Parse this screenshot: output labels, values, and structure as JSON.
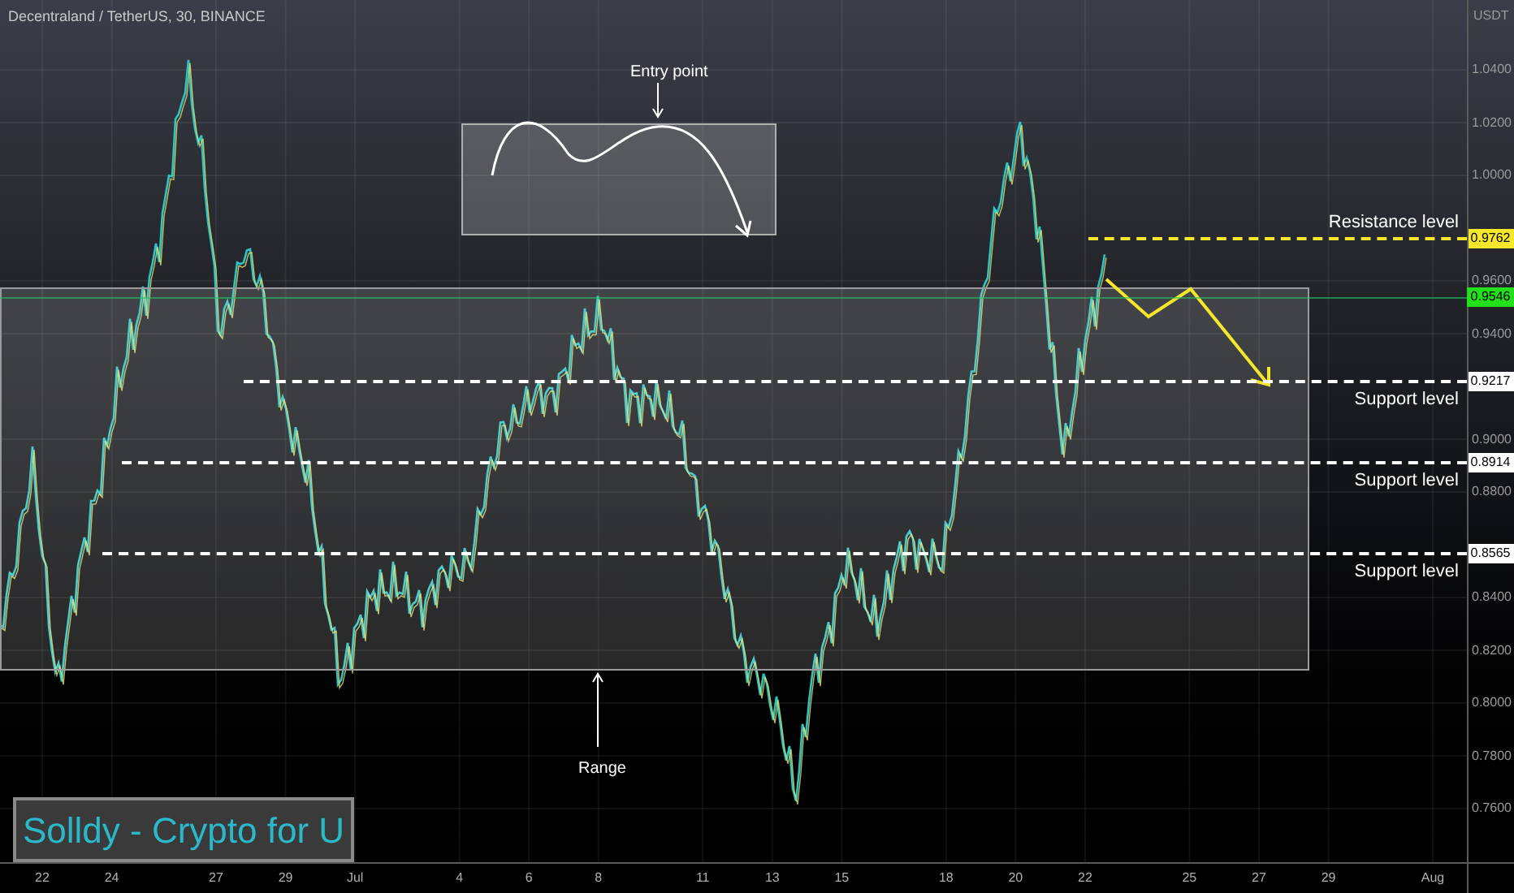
{
  "header": {
    "title": "Decentraland / TetherUS, 30, BINANCE"
  },
  "price_axis": {
    "unit": "USDT",
    "ticks": [
      "1.0400",
      "1.0200",
      "1.0000",
      "0.9600",
      "0.9400",
      "0.9000",
      "0.8800",
      "0.8400",
      "0.8200",
      "0.8000",
      "0.7800",
      "0.7600"
    ]
  },
  "time_axis": {
    "ticks": [
      "22",
      "24",
      "27",
      "29",
      "Jul",
      "4",
      "6",
      "8",
      "11",
      "13",
      "15",
      "18",
      "20",
      "22",
      "25",
      "27",
      "29",
      "Aug"
    ]
  },
  "levels": [
    {
      "kind": "resistance",
      "label": "Resistance level",
      "price": "0.9762"
    },
    {
      "kind": "support",
      "label": "Support level",
      "price": "0.9217"
    },
    {
      "kind": "support",
      "label": "Support level",
      "price": "0.8914"
    },
    {
      "kind": "support",
      "label": "Support level",
      "price": "0.8565"
    }
  ],
  "current_price": "0.9546",
  "annotations": {
    "entry": "Entry point",
    "range": "Range"
  },
  "branding": "Solldy - Crypto for U"
}
